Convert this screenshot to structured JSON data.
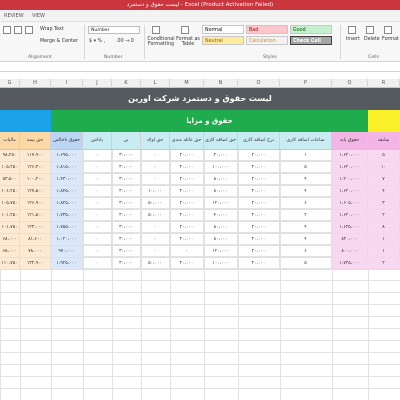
{
  "window": {
    "title": "لیست حقوق و دستمزد - Excel (Product Activation Failed)"
  },
  "ribbon_tabs": [
    "REVIEW",
    "VIEW"
  ],
  "ribbon": {
    "wrap_text": "Wrap Text",
    "merge_center": "Merge & Center",
    "number_format": "Number",
    "currency_symbols": "$ ▾ % ,",
    "decimal_buttons": ".00 →.0",
    "conditional_formatting": "Conditional Formatting",
    "format_as_table": "Format as Table",
    "styles": {
      "normal": "Normal",
      "bad": "Bad",
      "good": "Good",
      "neutral": "Neutral",
      "calculation": "Calculation",
      "check_cell": "Check Cell"
    },
    "insert": "Insert",
    "delete": "Delete",
    "format": "Format",
    "group_alignment": "Alignment",
    "group_number": "Number",
    "group_styles": "Styles",
    "group_cells": "Cells"
  },
  "column_headers": [
    "G",
    "H",
    "I",
    "J",
    "K",
    "L",
    "M",
    "N",
    "O",
    "P",
    "Q",
    "R"
  ],
  "sheet": {
    "banner_title": "لیست حقوق و دستمزد شرکت اورین",
    "group_label": "حقوق و مزایا",
    "headers": [
      "مالیات",
      "حق بیمه",
      "حقوق ناخالص",
      "پاداش",
      "بن",
      "حق اولاد",
      "حق عائله مندی",
      "حق اضافه کاری",
      "نرخ اضافه کاری",
      "ساعات اضافه کاری",
      "حقوق پایه",
      "سابقه"
    ],
    "rows": [
      [
        "۹۸،۲۵۰",
        "۱۱۷،۹۰۰",
        "۱،۶۹۵،۰۰۰",
        "۰",
        "۳۰،۰۰۰",
        "۰",
        "۲۰،۰۰۰",
        "۲۰،۰۰۰",
        "۲۰،۰۰۰",
        "۱",
        "۱،۶۲۰،۰۰۰",
        "۵"
      ],
      [
        "۱۰۵،۲۵۰",
        "۱۲۶،۳۰۰",
        "۱،۸۱۵،۰۰۰",
        "۰",
        "۳۰،۰۰۰",
        "۰",
        "۲۰،۰۰۰",
        "۱۰۰،۰۰۰",
        "۲۰،۰۰۰",
        "۵",
        "۱،۶۲۰،۰۰۰",
        "۱۰"
      ],
      [
        "۸۳،۵۰۰",
        "۱۰۰،۲۰۰",
        "۱،۴۳۰،۰۰۰",
        "۰",
        "۳۰،۰۰۰",
        "۰",
        "۲۰،۰۰۰",
        "۸۰،۰۰۰",
        "۲۰،۰۰۰",
        "۴",
        "۱،۲۰۰،۰۰۰",
        "۷"
      ],
      [
        "۱۰۶،۲۵۰",
        "۱۲۷،۵۰۰",
        "۱،۸۴۵،۰۰۰",
        "۰",
        "۳۰،۰۰۰",
        "۱۰،۰۰۰",
        "۲۰،۰۰۰",
        "۸۰،۰۰۰",
        "۲۰،۰۰۰",
        "۴",
        "۱،۶۲۰،۰۰۰",
        "۴"
      ],
      [
        "۱۰۵،۷۵۰",
        "۱۲۶،۹۰۰",
        "۱،۸۲۵،۰۰۰",
        "۰",
        "۳۰،۰۰۰",
        "۵۰،۰۰۰",
        "۲۰،۰۰۰",
        "۱۲۰،۰۰۰",
        "۲۰،۰۰۰",
        "۶",
        "۱،۶۰۵،۰۰۰",
        "۳"
      ],
      [
        "۱۰۱،۲۵۰",
        "۱۲۱،۵۰۰",
        "۱،۷۳۵،۰۰۰",
        "۰",
        "۳۰،۰۰۰",
        "۵۰،۰۰۰",
        "۲۰،۰۰۰",
        "۴۰،۰۰۰",
        "۲۰،۰۰۰",
        "۲",
        "۱،۶۲۰،۰۰۰",
        "۲"
      ],
      [
        "۱۰۱،۷۵۰",
        "۱۲۳،۰۰۰",
        "۱،۷۵۵،۰۰۰",
        "۰",
        "۳۰،۰۰۰",
        "۰",
        "۲۰،۰۰۰",
        "۸۰،۰۰۰",
        "۲۰،۰۰۰",
        "۴",
        "۱،۶۲۵،۰۰۰",
        "۸"
      ],
      [
        "۶۸،۰۰۰",
        "۸۱،۶۰۰",
        "۱،۰۲۰،۰۰۰",
        "۰",
        "۳۰،۰۰۰",
        "۰",
        "۲۰،۰۰۰",
        "۸۰،۰۰۰",
        "۲۰،۰۰۰",
        "۴",
        "۸۲۰،۰۰۰",
        "۱"
      ],
      [
        "۶۵،۰۰۰",
        "۷۸،۰۰۰",
        "۹۷۰،۰۰۰",
        "۰",
        "۳۰،۰۰۰",
        "۰",
        "۰",
        "۱۲۰،۰۰۰",
        "۲۰،۰۰۰",
        "۶",
        "۸۰۰،۰۰۰",
        "۱"
      ],
      [
        "۱۱۰،۷۵۰",
        "۱۳۲،۹۰۰",
        "۱،۹۲۵،۰۰۰",
        "۰",
        "۳۰،۰۰۰",
        "۵۰،۰۰۰",
        "۲۰،۰۰۰",
        "۱۰۰،۰۰۰",
        "۲۰،۰۰۰",
        "۵",
        "۱،۷۲۵،۰۰۰",
        "۲"
      ]
    ]
  },
  "colors": {
    "banner": "#555a5e",
    "blue": "#1aa3e8",
    "green": "#1eac4d",
    "yellow": "#f9f02a",
    "peach": "#fdd8a7",
    "pink": "#f2b5e6",
    "title_bar": "#c9363e"
  }
}
